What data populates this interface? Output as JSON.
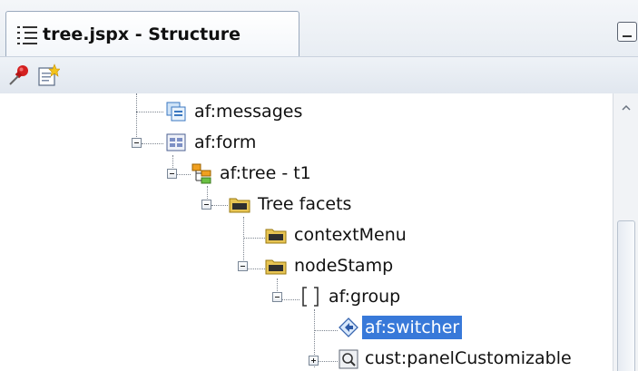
{
  "panel": {
    "title": "tree.jspx - Structure"
  },
  "toolbar": {
    "buttons": [
      {
        "icon": "pushpin-icon"
      },
      {
        "icon": "edit-document-icon"
      }
    ]
  },
  "tree": {
    "nodes": [
      {
        "label": "af:messages",
        "icon": "messages-icon"
      },
      {
        "label": "af:form",
        "icon": "form-icon",
        "expanded": true
      },
      {
        "label": "af:tree - t1",
        "icon": "tree-icon",
        "expanded": true
      },
      {
        "label": "Tree facets",
        "icon": "folder-icon",
        "expanded": true
      },
      {
        "label": "contextMenu",
        "icon": "folder-icon"
      },
      {
        "label": "nodeStamp",
        "icon": "folder-icon",
        "expanded": true
      },
      {
        "label": "af:group",
        "icon": "group-brackets-icon",
        "expanded": true
      },
      {
        "label": "af:switcher",
        "icon": "switcher-diamond-icon",
        "selected": true
      },
      {
        "label": "cust:panelCustomizable",
        "icon": "panel-customizable-icon",
        "expanded": false
      }
    ]
  },
  "colors": {
    "selection": "#3879d9",
    "tab_border": "#9aa9bd"
  }
}
